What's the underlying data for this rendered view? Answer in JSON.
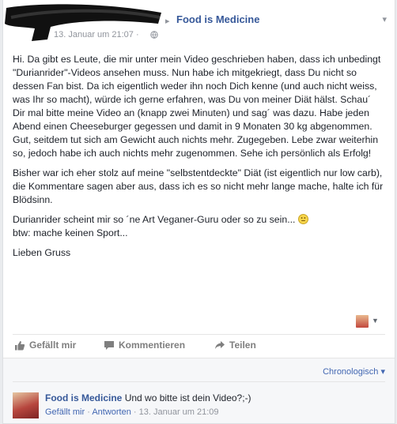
{
  "post": {
    "author_arrow": "▸",
    "page_name": "Food is Medicine",
    "timestamp": "13. Januar um 21:07 ·",
    "paragraphs": [
      "Hi. Da gibt es Leute, die mir unter mein Video geschrieben haben, dass ich unbedingt \"Durianrider\"-Videos ansehen muss. Nun habe ich mitgekriegt, dass Du nicht so dessen Fan bist. Da ich eigentlich weder ihn noch Dich kenne (und auch nicht weiss, was Ihr so macht), würde ich gerne erfahren, was Du von meiner Diät hälst. Schau´ Dir mal bitte meine Video an (knapp zwei Minuten) und sag´ was dazu. Habe jeden Abend einen Cheeseburger gegessen und damit in 9 Monaten 30 kg abgenommen. Gut, seitdem tut sich am Gewicht auch nichts mehr. Zugegeben. Lebe zwar weiterhin so, jedoch habe ich auch nichts mehr zugenommen. Sehe ich persönlich als Erfolg!",
      "Bisher war ich eher stolz auf meine \"selbstentdeckte\" Diät (ist eigentlich nur low carb), die Kommentare sagen aber aus, dass ich es so nicht mehr lange mache, halte ich für Blödsinn.",
      "Durianrider scheint mir so ´ne Art Veganer-Guru oder so zu sein...",
      "btw: mache keinen Sport...",
      "Lieben Gruss"
    ]
  },
  "actions": {
    "like": "Gefällt mir",
    "comment": "Kommentieren",
    "share": "Teilen"
  },
  "comments": {
    "sort_label": "Chronologisch ▾",
    "items": [
      {
        "name": "Food is Medicine",
        "text": "Und wo bitte ist dein Video?;-)",
        "like": "Gefällt mir",
        "reply": "Antworten",
        "separator": "·",
        "time": "13. Januar um 21:09"
      }
    ]
  },
  "icons": {
    "like": "thumbs-up-icon",
    "comment": "speech-bubble-icon",
    "share": "share-arrow-icon",
    "privacy": "globe-icon",
    "emoji": "smiley-icon"
  },
  "colors": {
    "link": "#365899",
    "muted": "#90949c",
    "background": "#e9ebee"
  }
}
